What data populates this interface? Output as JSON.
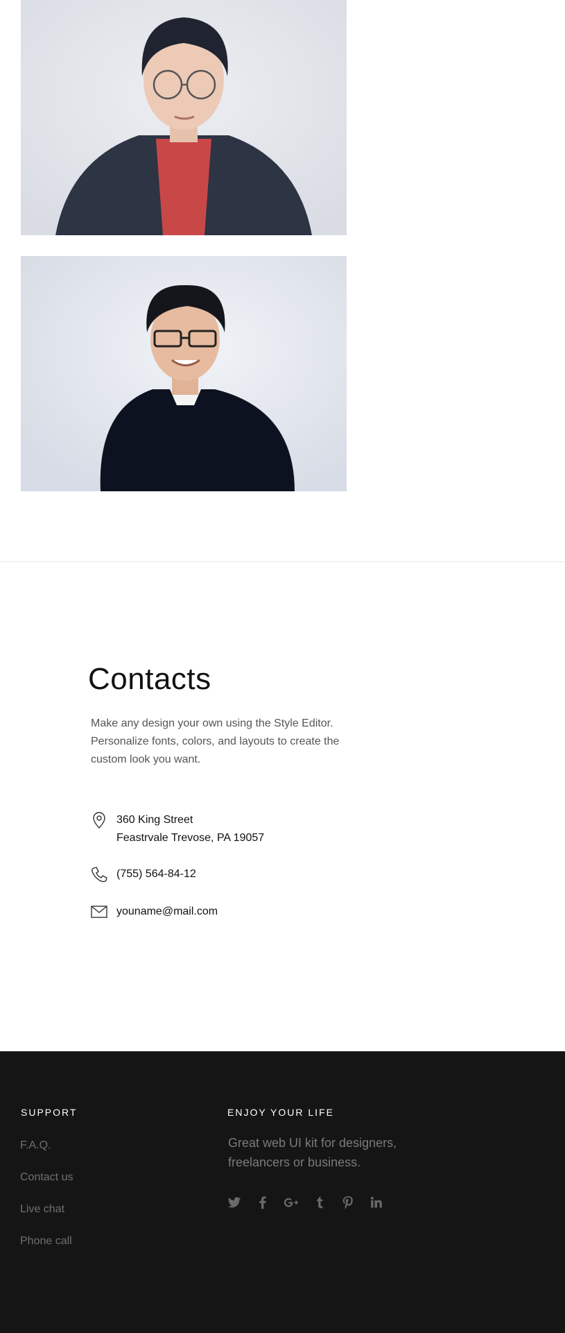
{
  "team": {
    "photos": [
      {
        "name": "team-member-photo-1"
      },
      {
        "name": "team-member-photo-2"
      }
    ]
  },
  "contacts": {
    "title": "Contacts",
    "description": "Make any design your own using the Style Editor. Personalize fonts, colors, and layouts to create the custom look you want.",
    "address_line1": "360 King Street",
    "address_line2": "Feastrvale Trevose, PA 19057",
    "phone": "(755) 564-84-12",
    "email": "youname@mail.com",
    "icons": [
      "location-pin-icon",
      "phone-icon",
      "mail-icon"
    ]
  },
  "footer": {
    "support_heading": "SUPPORT",
    "support_links": [
      "F.A.Q.",
      "Contact us",
      "Live chat",
      "Phone call"
    ],
    "enjoy_heading": "ENJOY YOUR LIFE",
    "enjoy_text": "Great web UI kit for designers, freelancers or business.",
    "social_icons": [
      "twitter-icon",
      "facebook-icon",
      "google-plus-icon",
      "tumblr-icon",
      "pinterest-icon",
      "linkedin-icon"
    ],
    "background_color": "#151515"
  }
}
